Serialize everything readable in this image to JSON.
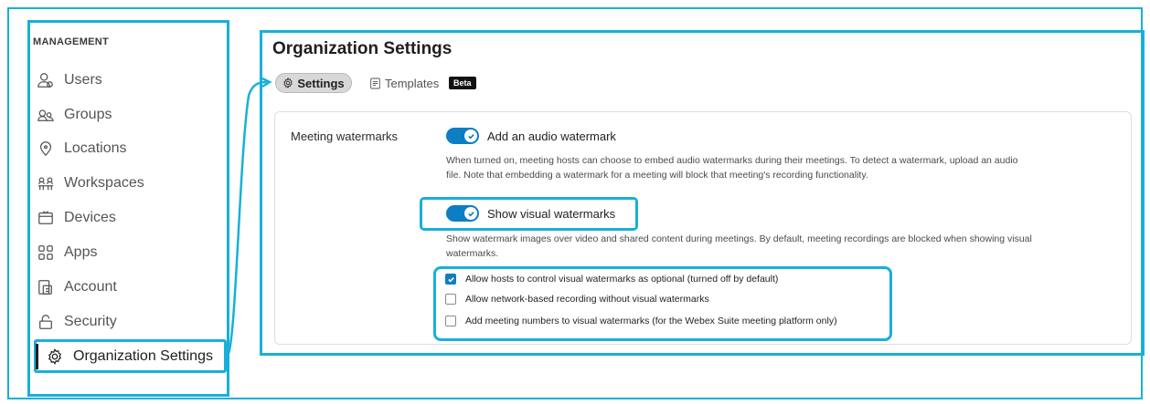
{
  "sidebar": {
    "section_label": "MANAGEMENT",
    "items": [
      {
        "label": "Users",
        "icon": "users-icon"
      },
      {
        "label": "Groups",
        "icon": "groups-icon"
      },
      {
        "label": "Locations",
        "icon": "location-pin-icon"
      },
      {
        "label": "Workspaces",
        "icon": "workspaces-icon"
      },
      {
        "label": "Devices",
        "icon": "devices-icon"
      },
      {
        "label": "Apps",
        "icon": "apps-grid-icon"
      },
      {
        "label": "Account",
        "icon": "account-icon"
      },
      {
        "label": "Security",
        "icon": "lock-icon"
      },
      {
        "label": "Organization Settings",
        "icon": "gear-icon",
        "active": true
      }
    ]
  },
  "main": {
    "title": "Organization Settings",
    "tabs": [
      {
        "label": "Settings",
        "icon": "gear-icon",
        "active": true
      },
      {
        "label": "Templates",
        "icon": "document-icon",
        "badge": "Beta"
      }
    ]
  },
  "watermarks": {
    "section_label": "Meeting watermarks",
    "audio": {
      "label": "Add an audio watermark",
      "enabled": true,
      "description_line1": "When turned on, meeting hosts can choose to embed audio watermarks during their meetings. To detect a watermark, upload an audio",
      "description_line2": "file. Note that embedding a watermark for a meeting will block that meeting's recording functionality."
    },
    "visual": {
      "label": "Show visual watermarks",
      "enabled": true,
      "description_line1": "Show watermark images over video and shared content during meetings. By default, meeting recordings are blocked when showing visual",
      "description_line2": "watermarks."
    },
    "options": [
      {
        "label": "Allow hosts to control visual watermarks as optional (turned off by default)",
        "checked": true
      },
      {
        "label": "Allow network-based recording without visual watermarks",
        "checked": false
      },
      {
        "label": "Add meeting numbers to visual watermarks (for the Webex Suite meeting platform only)",
        "checked": false
      }
    ]
  },
  "colors": {
    "highlight": "#17b0d8",
    "toggle_on": "#0d7ec4"
  }
}
